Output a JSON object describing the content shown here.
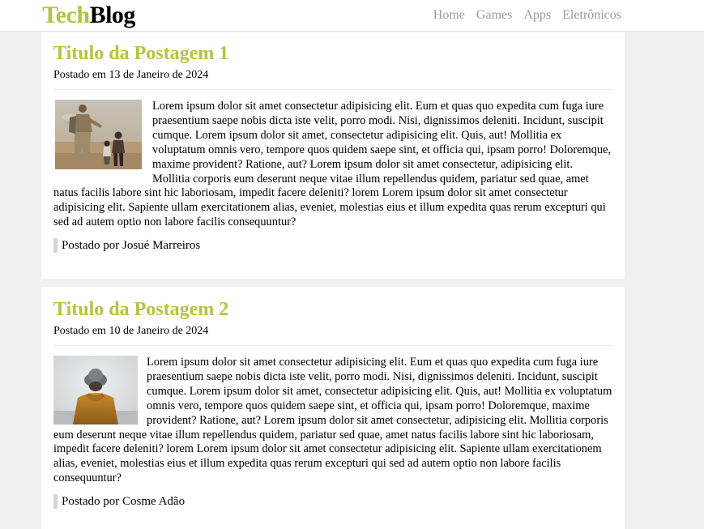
{
  "header": {
    "logo_part1": "Tech",
    "logo_part2": "Blog",
    "nav": [
      "Home",
      "Games",
      "Apps",
      "Eletrônicos"
    ]
  },
  "posts": [
    {
      "title": "Titulo da Postagem 1",
      "date": "Postado em 13 de Janeiro de 2024",
      "image": "soldier-and-child-photo",
      "text": "Lorem ipsum dolor sit amet consectetur adipisicing elit. Eum et quas quo expedita cum fuga iure praesentium saepe nobis dicta iste velit, porro modi. Nisi, dignissimos deleniti. Incidunt, suscipit cumque. Lorem ipsum dolor sit amet, consectetur adipisicing elit. Quis, aut! Mollitia ex voluptatum omnis vero, tempore quos quidem saepe sint, et officia qui, ipsam porro! Doloremque, maxime provident? Ratione, aut? Lorem ipsum dolor sit amet consectetur, adipisicing elit. Mollitia corporis eum deserunt neque vitae illum repellendus quidem, pariatur sed quae, amet natus facilis labore sint hic laboriosam, impedit facere deleniti? lorem Lorem ipsum dolor sit amet consectetur adipisicing elit. Sapiente ullam exercitationem alias, eveniet, molestias eius et illum expedita quas rerum excepturi qui sed ad autem optio non labore facilis consequuntur?",
      "author": "Postado por Josué Marreiros"
    },
    {
      "title": "Titulo da Postagem 2",
      "date": "Postado em 10 de Janeiro de 2024",
      "image": "person-in-hat-photo",
      "text": "Lorem ipsum dolor sit amet consectetur adipisicing elit. Eum et quas quo expedita cum fuga iure praesentium saepe nobis dicta iste velit, porro modi. Nisi, dignissimos deleniti. Incidunt, suscipit cumque. Lorem ipsum dolor sit amet, consectetur adipisicing elit. Quis, aut! Mollitia ex voluptatum omnis vero, tempore quos quidem saepe sint, et officia qui, ipsam porro! Doloremque, maxime provident? Ratione, aut? Lorem ipsum dolor sit amet consectetur, adipisicing elit. Mollitia corporis eum deserunt neque vitae illum repellendus quidem, pariatur sed quae, amet natus facilis labore sint hic laboriosam, impedit facere deleniti? lorem Lorem ipsum dolor sit amet consectetur adipisicing elit. Sapiente ullam exercitationem alias, eveniet, molestias eius et illum expedita quas rerum excepturi qui sed ad autem optio non labore facilis consequuntur?",
      "author": "Postado por Cosme Adão"
    }
  ]
}
